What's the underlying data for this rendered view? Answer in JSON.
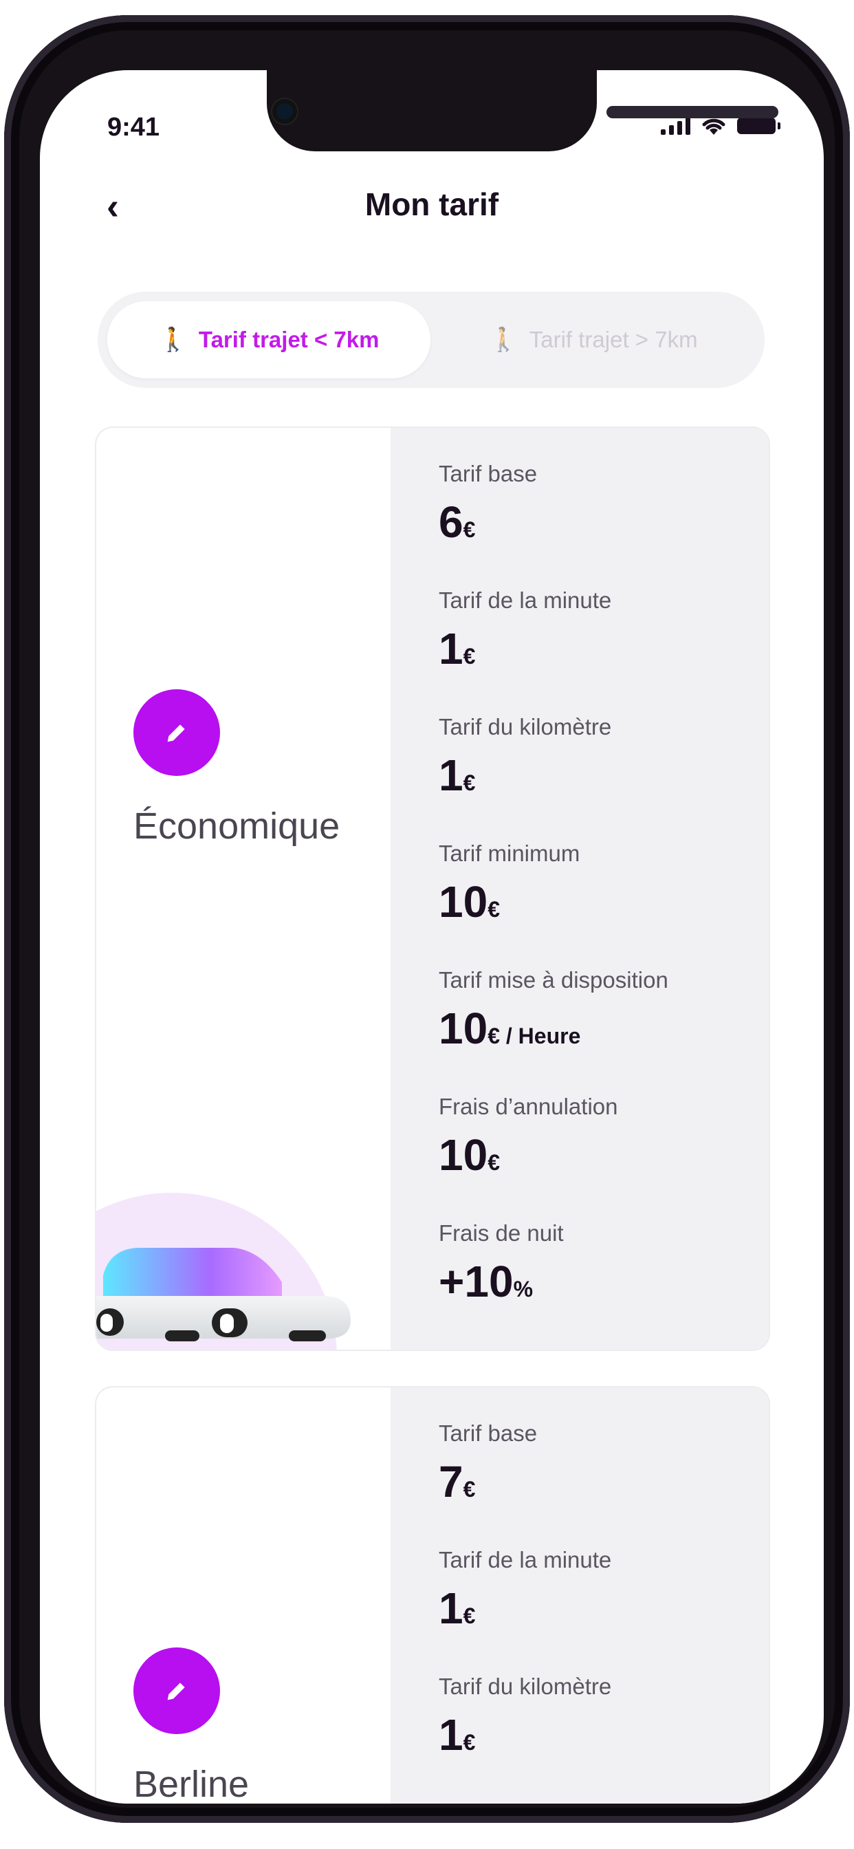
{
  "status_bar": {
    "time": "9:41"
  },
  "header": {
    "title": "Mon tarif"
  },
  "tabs": [
    {
      "label": "Tarif trajet < 7km"
    },
    {
      "label": "Tarif trajet > 7km"
    }
  ],
  "cards": [
    {
      "vehicle": "Économique",
      "rates": [
        {
          "label": "Tarif base",
          "value": "6",
          "unit": "€",
          "suffix": ""
        },
        {
          "label": "Tarif de la minute",
          "value": "1",
          "unit": "€",
          "suffix": ""
        },
        {
          "label": "Tarif du kilomètre",
          "value": "1",
          "unit": "€",
          "suffix": ""
        },
        {
          "label": "Tarif minimum",
          "value": "10",
          "unit": "€",
          "suffix": ""
        },
        {
          "label": "Tarif mise à disposition",
          "value": "10",
          "unit": "€",
          "suffix": " / Heure"
        },
        {
          "label": "Frais d’annulation",
          "value": "10",
          "unit": "€",
          "suffix": ""
        },
        {
          "label": "Frais de nuit",
          "value": "+10",
          "unit": "%",
          "suffix": ""
        }
      ]
    },
    {
      "vehicle": "Berline",
      "rates": [
        {
          "label": "Tarif base",
          "value": "7",
          "unit": "€",
          "suffix": ""
        },
        {
          "label": "Tarif de la minute",
          "value": "1",
          "unit": "€",
          "suffix": ""
        },
        {
          "label": "Tarif du kilomètre",
          "value": "1",
          "unit": "€",
          "suffix": ""
        }
      ]
    }
  ],
  "colors": {
    "accent": "#c21bea",
    "edit_button": "#b70ff0",
    "card_panel": "#f1f1f4",
    "text_dark": "#1a1020"
  },
  "icons": [
    "chevron-left-icon",
    "walking-person-icon",
    "pencil-icon",
    "signal-icon",
    "wifi-icon",
    "battery-icon"
  ]
}
